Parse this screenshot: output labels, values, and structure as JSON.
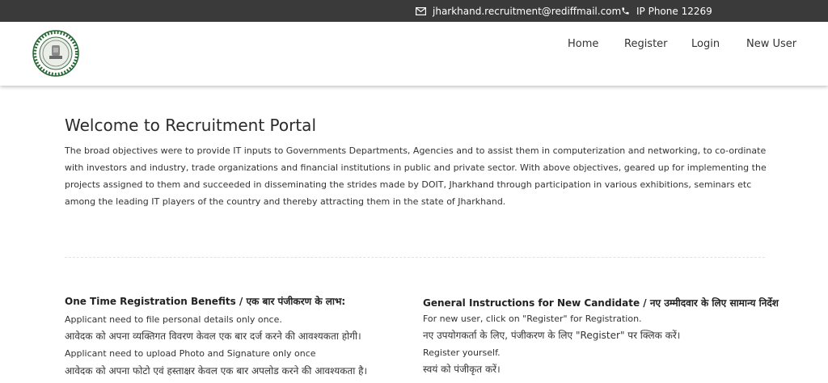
{
  "topbar": {
    "email": "jharkhand.recruitment@rediffmail.com",
    "phone": "IP Phone 12269"
  },
  "nav": {
    "home": "Home",
    "register": "Register",
    "login": "Login",
    "new_user": "New User"
  },
  "main": {
    "title": "Welcome to Recruitment Portal",
    "intro": "The broad objectives were to provide IT inputs to Governments Departments, Agencies and to assist them in computerization and networking, to co-ordinate with investors and industry, trade organizations and financial institutions in public and private sector. With above objectives, geared up for implementing the projects assigned to them and succeeded in disseminating the strides made by DOIT, Jharkhand through participation in various exhibitions, seminars etc among the leading IT players of the country and thereby attracting them in the state of Jharkhand."
  },
  "benefits": {
    "title": "One Time Registration Benefits / एक बार पंजीकरण के लाभ:",
    "items": [
      "Applicant need to file personal details only once.",
      "आवेदक को अपना व्यक्तिगत विवरण केवल एक बार दर्ज करने की आवश्यकता होगी।",
      "Applicant need to upload Photo and Signature only once",
      "आवेदक को अपना फोटो एवं हस्ताक्षर केवल एक बार अपलोड करने की आवश्यकता है।"
    ]
  },
  "instructions": {
    "title": "General Instructions for New Candidate / नए उम्मीदवार के लिए सामान्य निर्देश",
    "items": [
      "For new user, click on \"Register\" for Registration.",
      "नए उपयोगकर्ता के लिए, पंजीकरण के लिए \"Register\" पर क्लिक करें।",
      "Register yourself.",
      "स्वयं को पंजीकृत करें।"
    ]
  },
  "colors": {
    "topbar_bg": "#3a3a3a",
    "text": "#333333"
  },
  "icons": {
    "email": "envelope-icon",
    "phone": "phone-icon",
    "logo": "government-emblem-logo"
  }
}
